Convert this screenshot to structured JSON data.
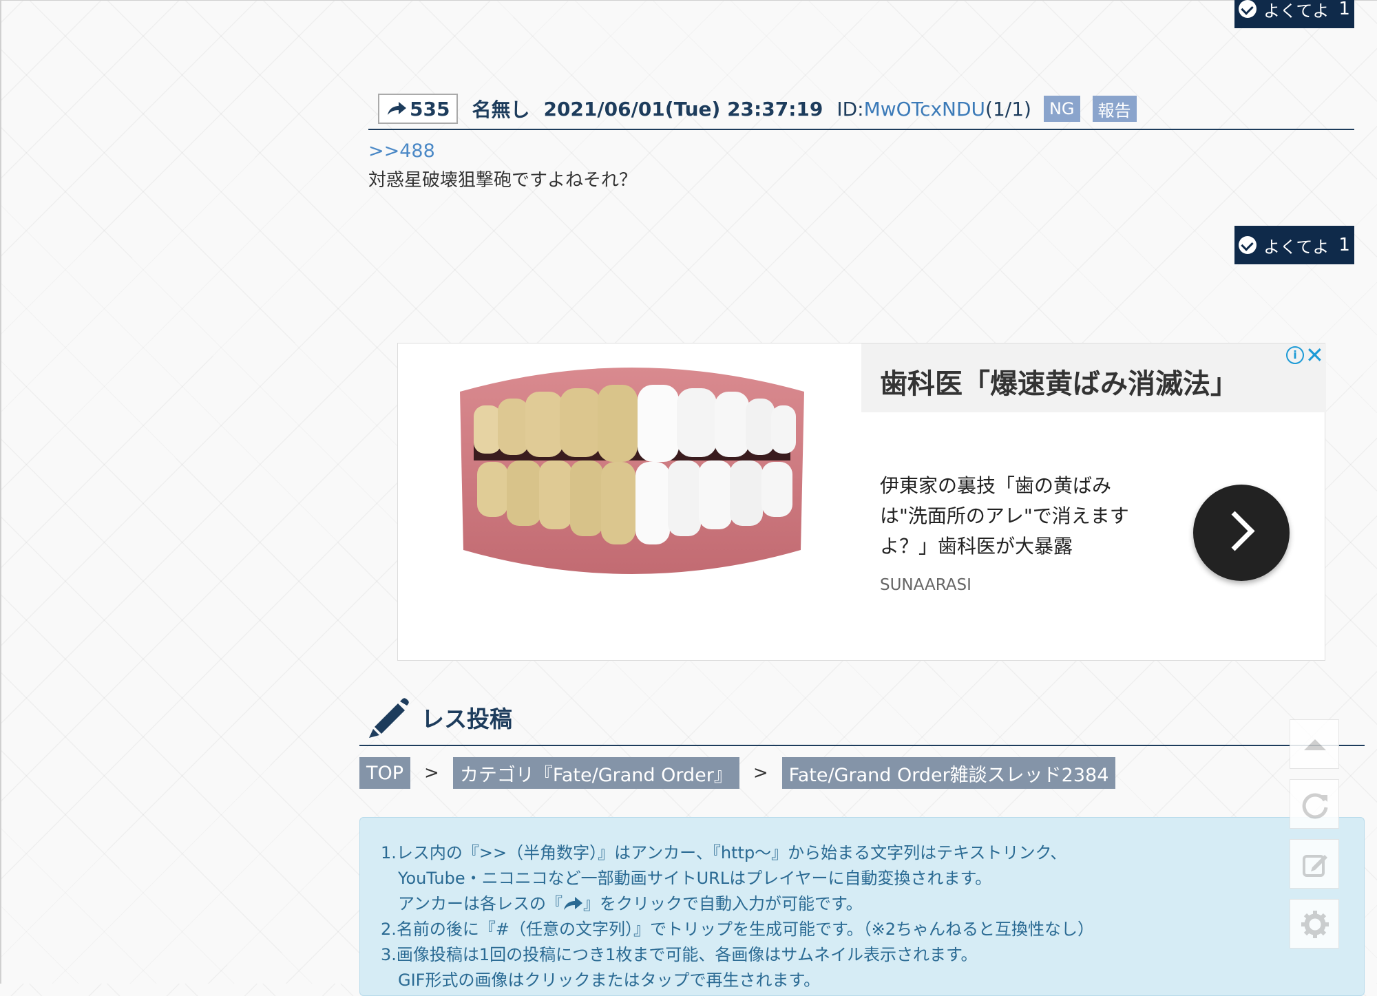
{
  "good_button": {
    "label": "よくてよ",
    "count": "1"
  },
  "post": {
    "number": "535",
    "name": "名無し",
    "datetime": "2021/06/01(Tue) 23:37:19",
    "id_prefix": "ID:",
    "id_value": "MwOTcxNDU",
    "id_count": "(1/1)",
    "ng_label": "NG",
    "report_label": "報告",
    "anchor": ">>488",
    "body": "対惑星破壊狙撃砲ですよねそれ？"
  },
  "ad": {
    "headline": "歯科医「爆速黄ばみ消滅法」",
    "body": "伊東家の裏技「歯の黄ばみは\"洗面所のアレ\"で消えますよ？」歯科医が大暴露",
    "source": "SUNAARASI"
  },
  "reply_section": {
    "title": "レス投稿"
  },
  "breadcrumb": {
    "items": [
      "TOP",
      "カテゴリ『Fate/Grand Order』",
      "Fate/Grand Order雑談スレッド2384"
    ],
    "separator": ">"
  },
  "rules": [
    "1.レス内の『>>（半角数字）』はアンカー、『http～』から始まる文字列はテキストリンク、",
    "YouTube・ニコニコなど一部動画サイトURLはプレイヤーに自動変換されます。",
    "アンカーは各レスの『",
    "』をクリックで自動入力が可能です。",
    "2.名前の後に『#（任意の文字列）』でトリップを生成可能です。（※2ちゃんねると互換性なし）",
    "3.画像投稿は1回の投稿につき1枚まで可能、各画像はサムネイル表示されます。",
    "GIF形式の画像はクリックまたはタップで再生されます。"
  ],
  "colors": {
    "navy": "#0f2a4a",
    "link": "#3b7ab8",
    "tag": "#8aa4cc",
    "info_bg": "#d6ecf5"
  }
}
